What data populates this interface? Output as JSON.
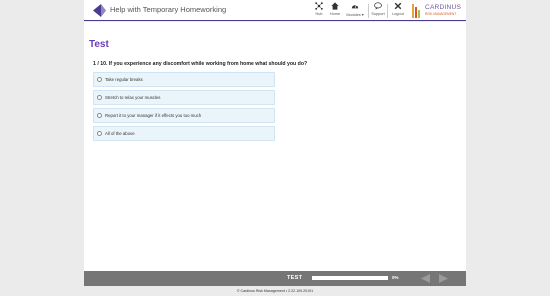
{
  "header": {
    "title": "Help with Temporary Homeworking",
    "nav": [
      {
        "label": "Hub",
        "icon": "hub-icon"
      },
      {
        "label": "Home",
        "icon": "home-icon"
      },
      {
        "label": "Modules ▾",
        "icon": "dashboard-icon"
      },
      {
        "label": "Support",
        "icon": "chat-icon"
      },
      {
        "label": "Logout",
        "icon": "close-icon"
      }
    ],
    "brand": {
      "name": "CARDINUS",
      "tagline": "RISK MANAGEMENT",
      "bar_colors": [
        "#e9a23b",
        "#d9532c",
        "#a3c644",
        "#6b5a9a"
      ]
    }
  },
  "main": {
    "title": "Test",
    "question": "1 / 10. If you experience any discomfort while working from home what should you do?",
    "options": [
      "Take regular breaks",
      "Stretch to relax your muscles",
      "Report it to your manager if it effects you too much",
      "All of the above"
    ]
  },
  "footer": {
    "title": "TEST",
    "progress_text": "0%",
    "progress_fraction": 0
  },
  "copyright": "© Cardinus Risk Management • 2.22.109.20191",
  "colors": {
    "accent": "#6a3db8",
    "header_rule": "#4b3c8f",
    "option_bg": "#eaf4fb",
    "footer_bg": "#767676"
  }
}
